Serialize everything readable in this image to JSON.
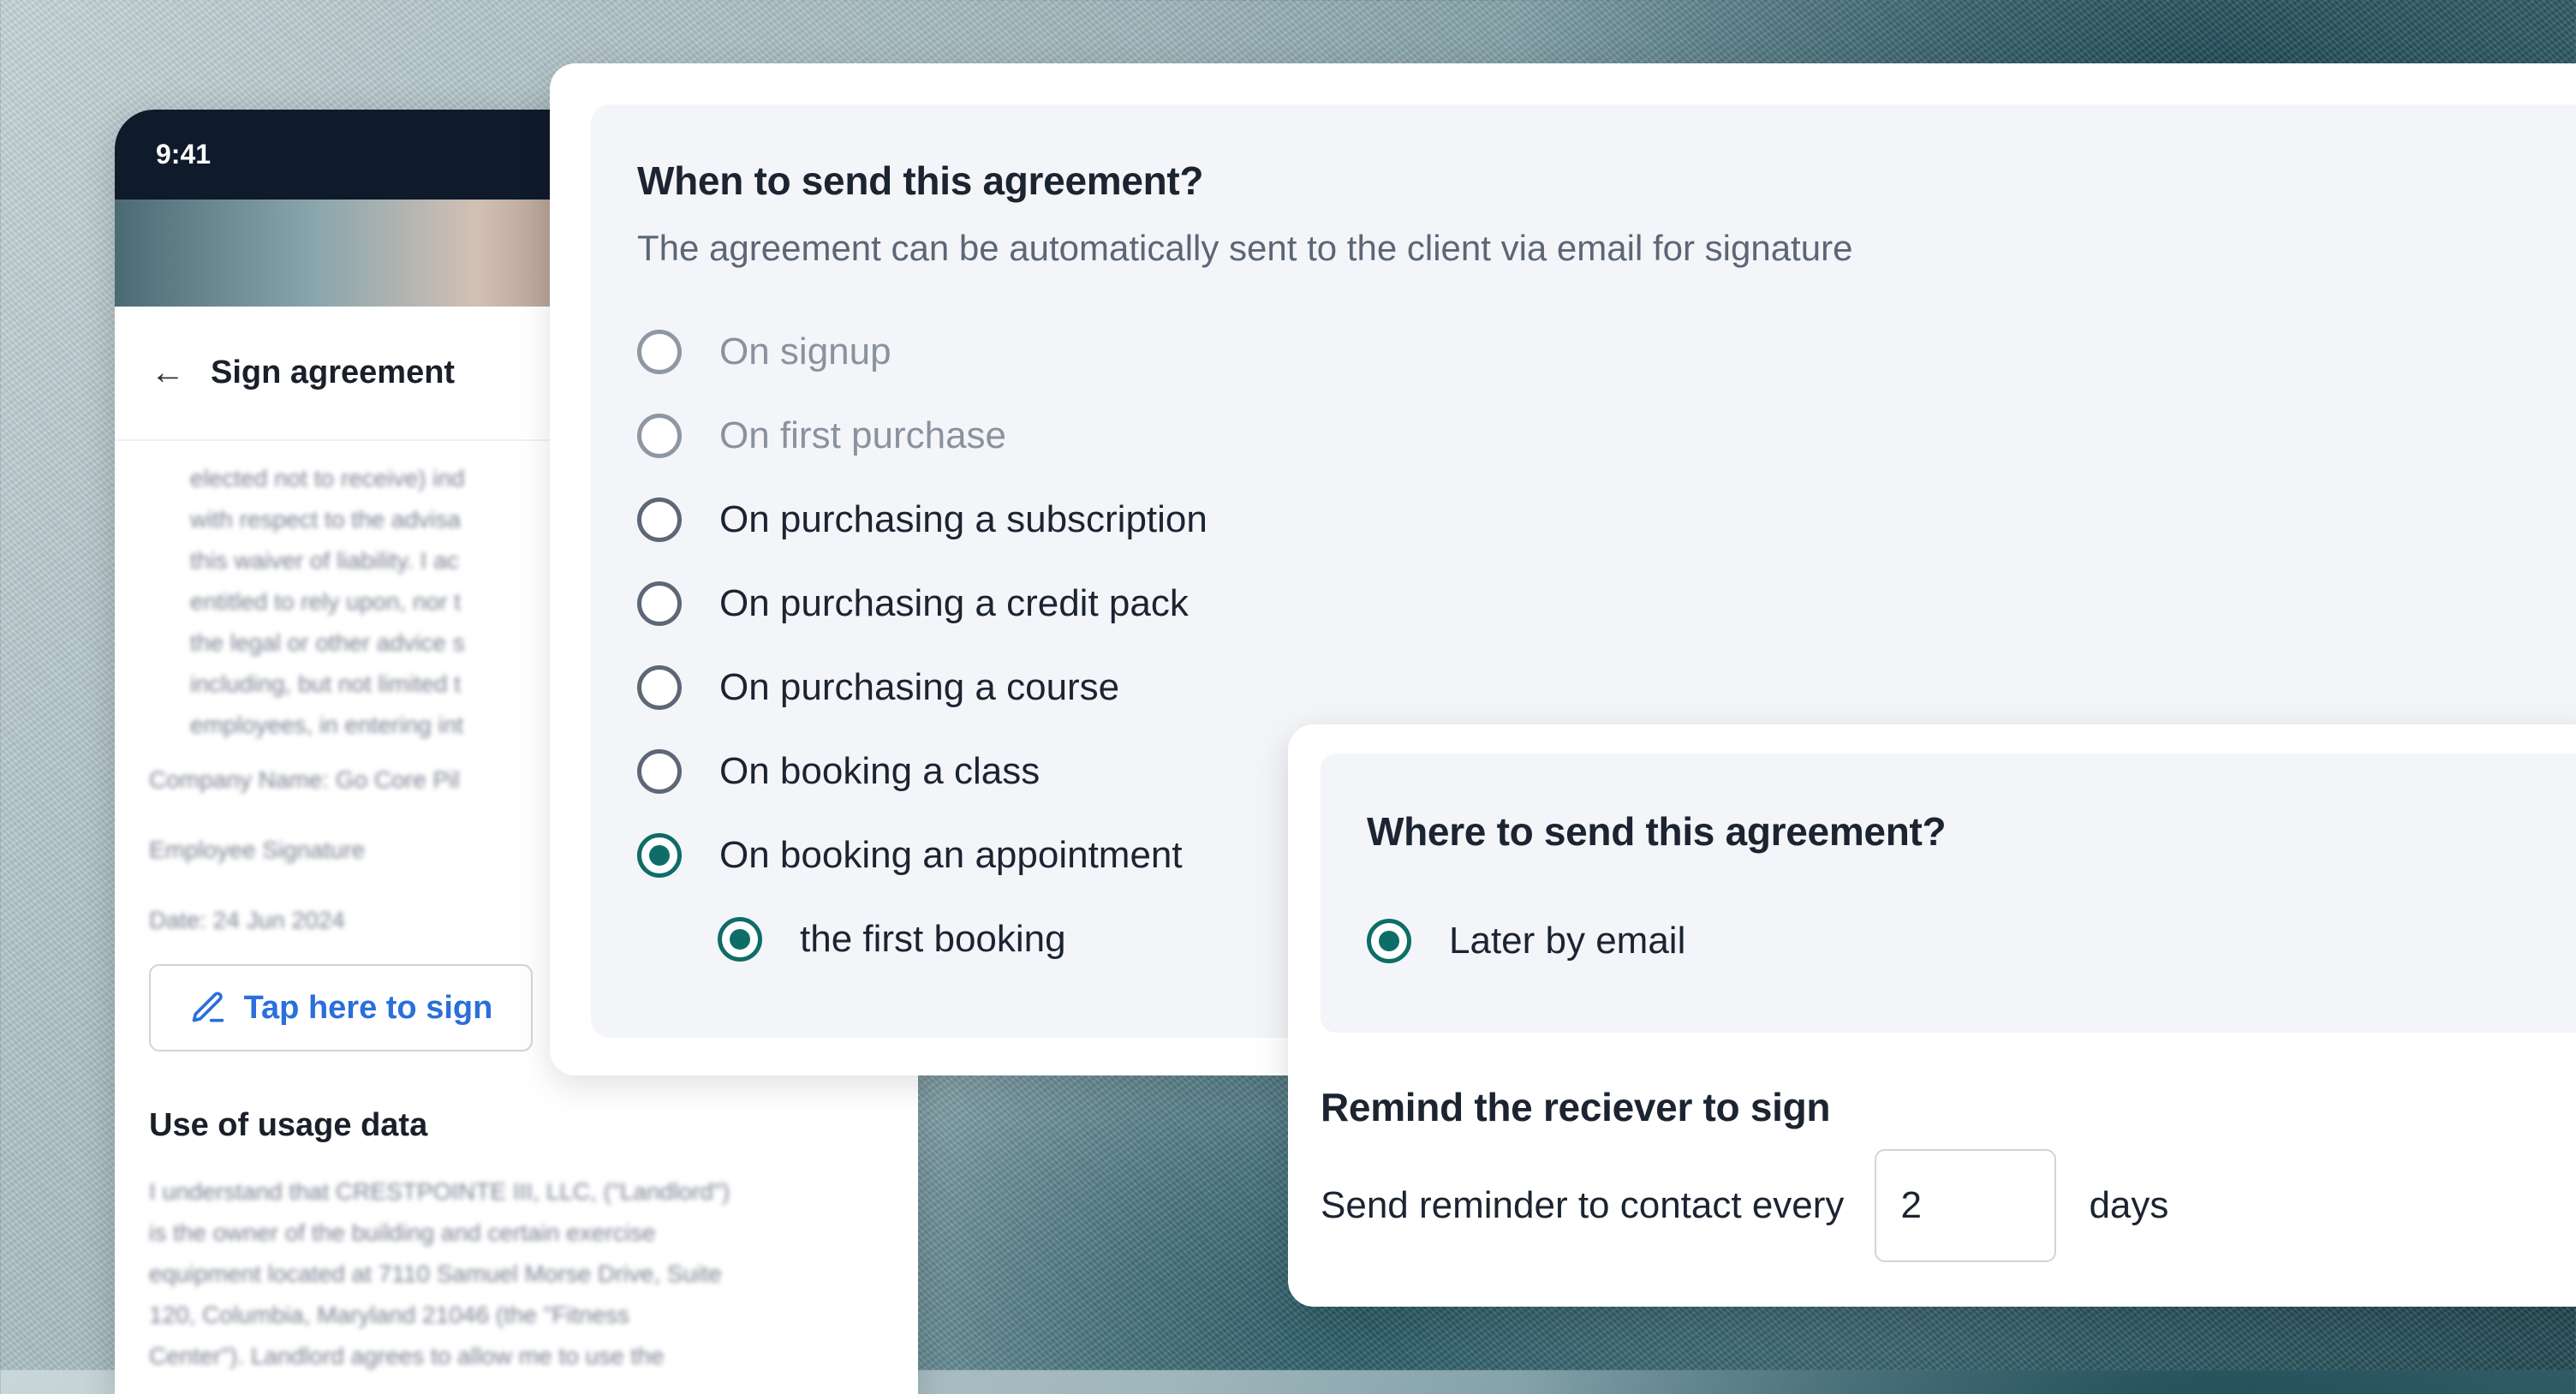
{
  "phone": {
    "time": "9:41",
    "header_title": "Sign agreement",
    "terms_lines": [
      "elected not to receive) ind",
      "with respect to the advisa",
      "this waiver of liability. I ac",
      "entitled to rely upon, nor t",
      "the legal or other advice s",
      "including, but not limited t",
      "employees, in entering int"
    ],
    "company_line": "Company Name: Go Core Pil",
    "employee_line": "Employee Signature",
    "date_line": "Date: 24 Jun 2024",
    "sign_button": "Tap here to sign",
    "usage_title": "Use of usage data",
    "usage_lines": [
      "I understand that CRESTPOINTE III, LLC, (\"Landlord\")",
      "is the owner of the building and certain exercise",
      "equipment located at 7110 Samuel Morse Drive, Suite",
      "120, Columbia, Maryland 21046 (the \"Fitness",
      "Center\"). Landlord agrees to allow me to use the"
    ]
  },
  "when": {
    "title": "When to send this agreement?",
    "subtitle": "The agreement can be automatically sent to the client via email for signature",
    "options": [
      {
        "label": "On signup",
        "state": "disabled"
      },
      {
        "label": "On first purchase",
        "state": "disabled"
      },
      {
        "label": "On purchasing a subscription",
        "state": "unchecked"
      },
      {
        "label": "On purchasing a credit pack",
        "state": "unchecked"
      },
      {
        "label": "On purchasing a course",
        "state": "unchecked"
      },
      {
        "label": "On booking a class",
        "state": "unchecked"
      },
      {
        "label": "On booking an appointment",
        "state": "checked"
      }
    ],
    "sub_option": {
      "label": "the first booking",
      "state": "checked"
    }
  },
  "where": {
    "title": "Where to send this agreement?",
    "option": {
      "label": "Later by email",
      "state": "checked"
    }
  },
  "reminder": {
    "title": "Remind the reciever to sign",
    "prefix": "Send reminder to contact every",
    "value": "2",
    "suffix": "days"
  },
  "colors": {
    "accent": "#0f6d68",
    "link": "#2a6fdb",
    "status_bar": "#0f1a2b"
  }
}
